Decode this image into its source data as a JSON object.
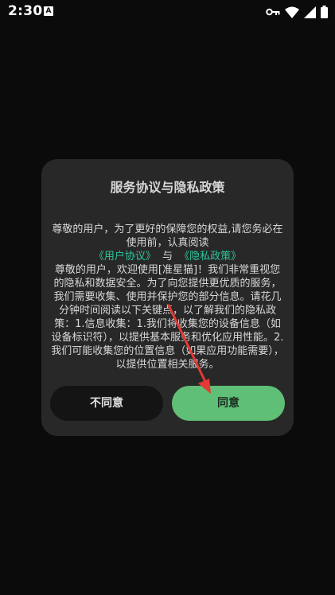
{
  "status_bar": {
    "time": "2:30",
    "notification_icon": "a-notification-icon",
    "notification_letter": "A",
    "icons": [
      "key-icon",
      "wifi-icon",
      "signal-icon",
      "battery-icon"
    ]
  },
  "dialog": {
    "title": "服务协议与隐私政策",
    "intro": "尊敬的用户，为了更好的保障您的权益,请您务必在使用前，认真阅读",
    "user_agreement_link": "《用户协议》",
    "and_text": "与",
    "privacy_policy_link": "《隐私政策》",
    "body": "尊敬的用户，欢迎使用[准星猫]！我们非常重视您的隐私和数据安全。为了向您提供更优质的服务，我们需要收集、使用并保护您的部分信息。请花几分钟时间阅读以下关键点，以了解我们的隐私政策：1.信息收集：1.我们将收集您的设备信息（如设备标识符），以提供基本服务和优化应用性能。2.我们可能收集您的位置信息（如果应用功能需要），以提供位置相关服务。",
    "disagree_label": "不同意",
    "agree_label": "同意"
  },
  "colors": {
    "background": "#0b0b0b",
    "dialog": "#282828",
    "link": "#2dc59a",
    "agree_button": "#5fbf76",
    "disagree_button": "#141414",
    "annotation_arrow": "#e53935"
  }
}
